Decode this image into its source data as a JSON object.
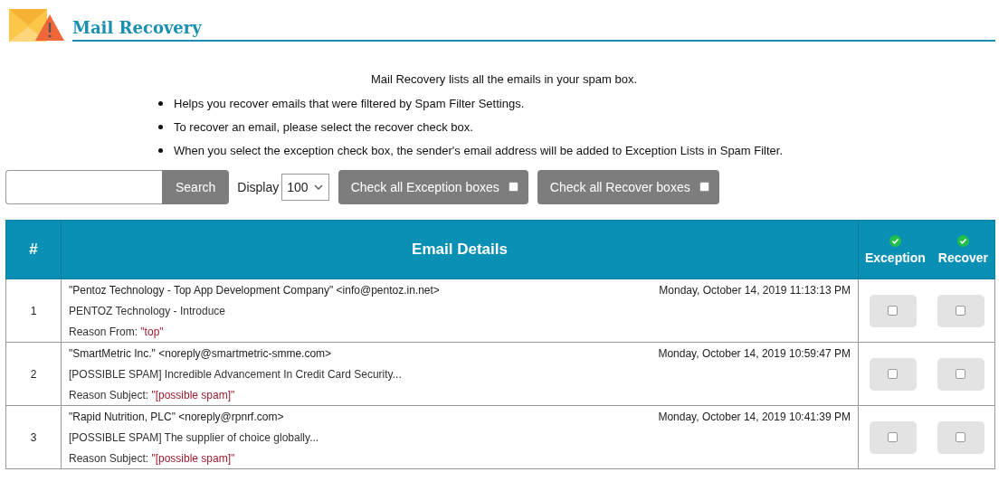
{
  "header": {
    "title": "Mail Recovery"
  },
  "intro": {
    "lead": "Mail Recovery lists all the emails in your spam box.",
    "bullets": [
      "Helps you recover emails that were filtered by Spam Filter Settings.",
      "To recover an email, please select the recover check box.",
      "When you select the exception check box, the sender's email address will be added to Exception Lists in Spam Filter."
    ]
  },
  "toolbar": {
    "search_button": "Search",
    "display_label": "Display",
    "display_value": "100",
    "buttons": [
      {
        "label": "Check all Exception boxes",
        "checked": false
      },
      {
        "label": "Check all Recover boxes",
        "checked": false
      }
    ]
  },
  "table": {
    "columns": [
      "#",
      "Email Details",
      "Exception",
      "Recover"
    ],
    "rows": [
      {
        "number": "1",
        "sender": "\"Pentoz Technology - Top App Development Company\" <info@pentoz.in.net>",
        "date": "Monday, October 14, 2019 11:13:13 PM",
        "subject": "PENTOZ Technology - Introduce",
        "reason_label": "Reason From: ",
        "reason_value": "\"top\"",
        "exception": false,
        "recover": false
      },
      {
        "number": "2",
        "sender": "\"SmartMetric Inc.\" <noreply@smartmetric-smme.com>",
        "date": "Monday, October 14, 2019 10:59:47 PM",
        "subject": "[POSSIBLE SPAM] Incredible Advancement In Credit Card Security...",
        "reason_label": "Reason Subject: ",
        "reason_value": "\"[possible spam]\"",
        "exception": false,
        "recover": false
      },
      {
        "number": "3",
        "sender": "\"Rapid Nutrition, PLC\" <noreply@rpnrf.com>",
        "date": "Monday, October 14, 2019 10:41:39 PM",
        "subject": "[POSSIBLE SPAM] The supplier of choice globally...",
        "reason_label": "Reason Subject: ",
        "reason_value": "\"[possible spam]\"",
        "exception": false,
        "recover": false
      }
    ]
  }
}
